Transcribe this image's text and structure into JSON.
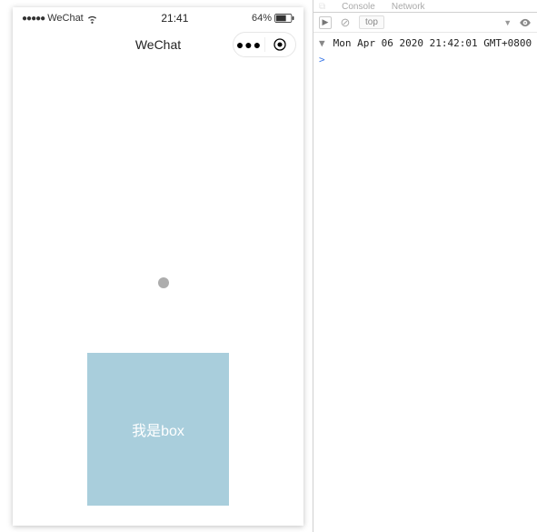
{
  "statusBar": {
    "carrier": "WeChat",
    "time": "21:41",
    "batteryPct": "64%",
    "signalDots": "●●●●●"
  },
  "navBar": {
    "title": "WeChat",
    "menuDots": "●●●"
  },
  "page": {
    "boxText": "我是box"
  },
  "devtools": {
    "tabs": {
      "elements": "",
      "console": "Console",
      "network": "Network",
      "more": ""
    },
    "toolbar": {
      "play": "▶",
      "clear": "⊘",
      "context": "top",
      "filterTri": "▼"
    },
    "console": {
      "line1": "Mon Apr 06 2020 21:42:01 GMT+0800",
      "prompt": ">"
    }
  }
}
